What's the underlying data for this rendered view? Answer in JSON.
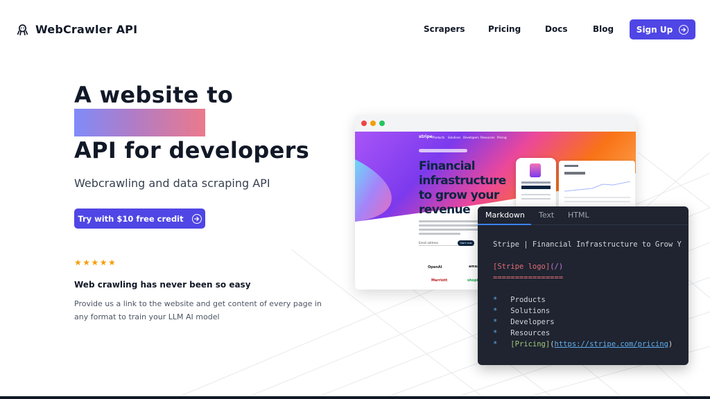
{
  "header": {
    "logo_text": "WebCrawler API",
    "logo_icon": "octopus-icon",
    "nav": [
      "Scrapers",
      "Pricing",
      "Docs",
      "Blog"
    ],
    "signup_label": "Sign Up",
    "signup_icon": "circle-arrow-right-icon",
    "accent": "#4f46e5"
  },
  "hero": {
    "title_line1": "A website to",
    "title_line2": "API for developers",
    "highlight_gradient": [
      "#7f8bf9",
      "#b07cc6",
      "#eb7a8c"
    ],
    "subtitle": "Webcrawling and data scraping API",
    "cta_label": "Try with $10 free credit",
    "stars": "★★★★★",
    "rating_value": 5,
    "tagline": "Web crawling has never been so easy",
    "description": "Provide us a link to the website and get content of every page in any format to train your LLM AI model"
  },
  "browser": {
    "site_brand": "stripe",
    "site_nav": [
      "Products",
      "Solutions",
      "Developers",
      "Resources",
      "Pricing"
    ],
    "headline": "Financial infrastructure to grow your revenue",
    "start_label": "Start now",
    "email_placeholder": "Email address",
    "logos": [
      "OpenAI",
      "amazon",
      "Marriott",
      "shopify"
    ],
    "dots": [
      "#ef4444",
      "#f59e0b",
      "#22c55e"
    ]
  },
  "code_panel": {
    "tabs": [
      "Markdown",
      "Text",
      "HTML"
    ],
    "active_tab": "Markdown",
    "line1": "Stripe | Financial Infrastructure to Grow Y",
    "logo_link_text": "[Stripe logo]",
    "logo_link_url": "(/)",
    "rule": "================",
    "bullets": [
      "Products",
      "Solutions",
      "Developers",
      "Resources"
    ],
    "pricing_text": "[Pricing]",
    "pricing_url": "https://stripe.com/pricing"
  }
}
